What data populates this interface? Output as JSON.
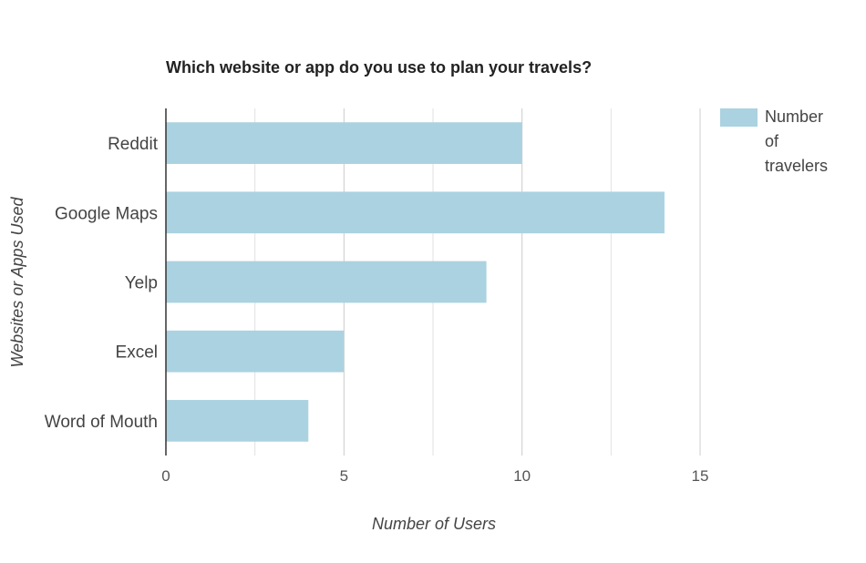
{
  "chart_data": {
    "type": "bar",
    "orientation": "horizontal",
    "title": "Which website or app do you use to plan your travels?",
    "xlabel": "Number of Users",
    "ylabel": "Websites or Apps Used",
    "categories": [
      "Reddit",
      "Google Maps",
      "Yelp",
      "Excel",
      "Word of Mouth"
    ],
    "series": [
      {
        "name": "Number of travelers",
        "values": [
          10,
          14,
          9,
          5,
          4
        ]
      }
    ],
    "legend_lines": [
      "Number",
      "of",
      "travelers"
    ],
    "xlim": [
      0,
      15
    ],
    "xticks": [
      0,
      5,
      10,
      15
    ],
    "grid": true,
    "legend_position": "right",
    "colors": {
      "bar": "#abd2e0",
      "grid": "#e2e2e2",
      "major_grid": "#cccccc",
      "axis": "#333333"
    }
  }
}
